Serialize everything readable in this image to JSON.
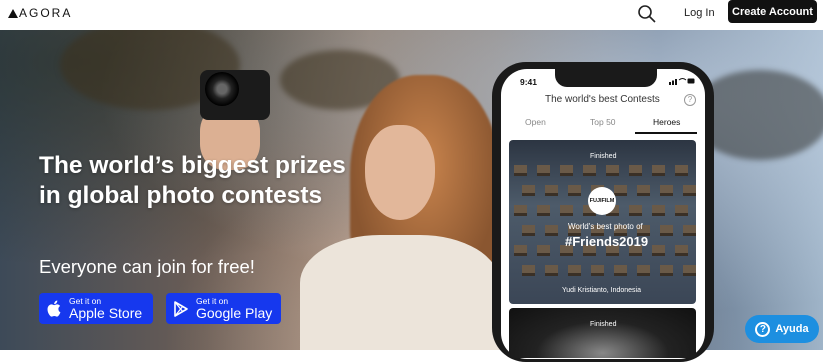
{
  "header": {
    "logo_text": "AGORA",
    "login_label": "Log In",
    "create_account_label": "Create Account",
    "search_icon": "search-icon"
  },
  "hero": {
    "headline_line1": "The world’s biggest prizes",
    "headline_line2": "in global photo contests",
    "subheadline": "Everyone can join for free!",
    "apple": {
      "small": "Get it on",
      "big": "Apple Store",
      "icon": "apple-icon"
    },
    "google": {
      "small": "Get it on",
      "big": "Google Play",
      "icon": "play-icon"
    }
  },
  "phone": {
    "time": "9:41",
    "title": "The world's best Contests",
    "help_icon": "?",
    "tabs": [
      "Open",
      "Top 50",
      "Heroes"
    ],
    "active_tab": "Heroes",
    "card1": {
      "status": "Finished",
      "sponsor": "FUJIFILM",
      "caption": "World's best photo of",
      "hashtag": "#Friends2019",
      "photographer": "Yudi Kristianto, Indonesia"
    },
    "card2": {
      "status": "Finished"
    }
  },
  "help_widget": {
    "label": "Ayuda",
    "icon": "?"
  },
  "colors": {
    "accent": "#1638ee",
    "help": "#1d8fe0",
    "dark": "#111111"
  }
}
